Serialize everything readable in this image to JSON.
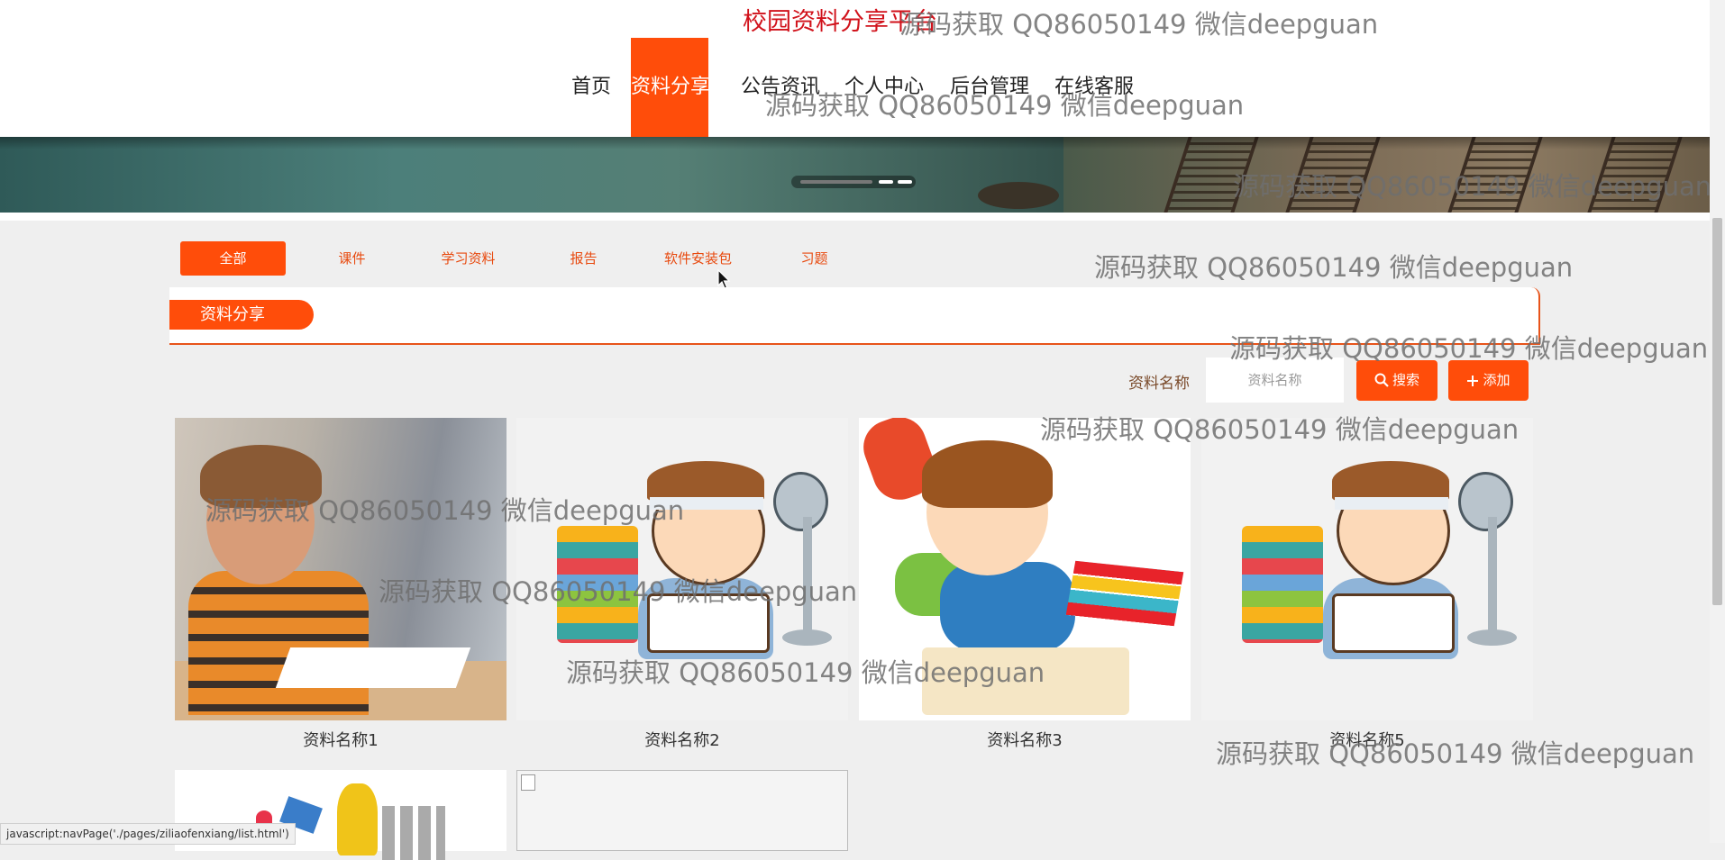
{
  "site": {
    "title": "校园资料分享平台"
  },
  "nav": [
    "首页",
    "资料分享",
    "公告资讯",
    "个人中心",
    "后台管理",
    "在线客服"
  ],
  "categories": [
    "全部",
    "课件",
    "学习资料",
    "报告",
    "软件安装包",
    "习题"
  ],
  "section": {
    "title": "资料分享"
  },
  "search": {
    "label": "资料名称",
    "placeholder": "资料名称",
    "search_button": "搜索",
    "add_button": "添加"
  },
  "items": [
    {
      "title": "资料名称1"
    },
    {
      "title": "资料名称2"
    },
    {
      "title": "资料名称3"
    },
    {
      "title": "资料名称5"
    }
  ],
  "status_bar": "javascript:navPage('./pages/ziliaofenxiang/list.html')",
  "watermark": "源码获取 QQ86050149 微信deepguan",
  "colors": {
    "accent": "#ff4d0a",
    "title": "#d1121b"
  }
}
